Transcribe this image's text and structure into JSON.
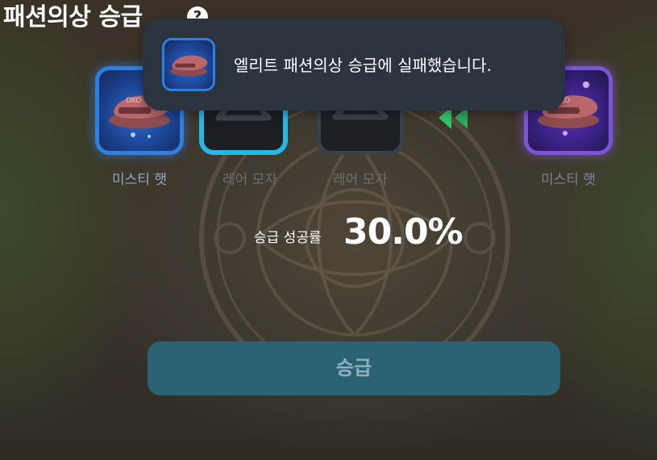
{
  "header": {
    "title": "패션의상 승급",
    "help_icon": "question-circle-icon"
  },
  "toast": {
    "message": "엘리트 패션의상 승급에 실패했습니다.",
    "item_icon": "hat-icon"
  },
  "slots": [
    {
      "label": "미스티 햇",
      "icon": "hat-icon",
      "frame_color": "#2f7fe0"
    },
    {
      "label": "레어 모자",
      "icon": "hanger-icon",
      "frame_color": "#27b7e6"
    },
    {
      "label": "레어 모자",
      "icon": "hanger-icon",
      "frame_color": "#3a4048"
    },
    {
      "label": "미스티 햇",
      "icon": "hat-icon",
      "frame_color": "#7b54d6"
    }
  ],
  "success_rate": {
    "label": "승급 성공률",
    "value": "30.0%"
  },
  "upgrade_button": {
    "label": "승급"
  }
}
